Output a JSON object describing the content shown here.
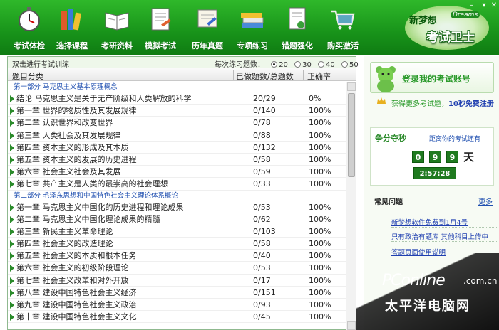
{
  "toolbar": {
    "items": [
      {
        "label": "考试体检",
        "icon": "stopwatch-icon"
      },
      {
        "label": "选择课程",
        "icon": "books-icon"
      },
      {
        "label": "考研资料",
        "icon": "open-book-icon"
      },
      {
        "label": "模拟考试",
        "icon": "exam-paper-icon"
      },
      {
        "label": "历年真题",
        "icon": "scroll-icon"
      },
      {
        "label": "专项练习",
        "icon": "book-stack-icon"
      },
      {
        "label": "错题强化",
        "icon": "document-pen-icon"
      },
      {
        "label": "购买激活",
        "icon": "shopping-cart-icon"
      }
    ],
    "logo": {
      "top": "新梦想",
      "en": "Dreams",
      "main": "考试卫士"
    }
  },
  "panel": {
    "hint": "双击进行考试训练",
    "qcount_label": "每次练习题数：",
    "qcount_options": [
      "20",
      "30",
      "40",
      "50"
    ],
    "qcount_selected": "20",
    "columns": {
      "category": "题目分类",
      "done": "已做题数/总题数",
      "rate": "正确率"
    },
    "sections": [
      {
        "title": "第一部分  马克思主义基本原理概念",
        "rows": [
          {
            "name": "结论  马克思主义是关于无产阶级和人类解放的科学",
            "done": "20/29",
            "rate": "0%"
          },
          {
            "name": "第一章  世界的物质性及其发展规律",
            "done": "0/140",
            "rate": "100%"
          },
          {
            "name": "第二章  认识世界和改变世界",
            "done": "0/78",
            "rate": "100%"
          },
          {
            "name": "第三章  人类社会及其发展规律",
            "done": "0/88",
            "rate": "100%"
          },
          {
            "name": "第四章  资本主义的形成及其本质",
            "done": "0/132",
            "rate": "100%"
          },
          {
            "name": "第五章  资本主义的发展的历史进程",
            "done": "0/58",
            "rate": "100%"
          },
          {
            "name": "第六章  社会主义社会及其发展",
            "done": "0/59",
            "rate": "100%"
          },
          {
            "name": "第七章  共产主义是人类的最崇高的社会理想",
            "done": "0/33",
            "rate": "100%"
          }
        ]
      },
      {
        "title": "第二部分  毛泽东思想和中国特色社会主义理论体系概论",
        "rows": [
          {
            "name": "第一章  马克思主义中国化的历史进程和理论成果",
            "done": "0/53",
            "rate": "100%"
          },
          {
            "name": "第二章  马克思主义中国化理论成果的精髓",
            "done": "0/62",
            "rate": "100%"
          },
          {
            "name": "第三章  新民主主义革命理论",
            "done": "0/103",
            "rate": "100%"
          },
          {
            "name": "第四章  社会主义的改造理论",
            "done": "0/58",
            "rate": "100%"
          },
          {
            "name": "第五章  社会主义的本质和根本任务",
            "done": "0/40",
            "rate": "100%"
          },
          {
            "name": "第六章  社会主义的初级阶段理论",
            "done": "0/53",
            "rate": "100%"
          },
          {
            "name": "第七章  社会主义改革和对外开放",
            "done": "0/17",
            "rate": "100%"
          },
          {
            "name": "第八章  建设中国特色社会主义经济",
            "done": "0/151",
            "rate": "100%"
          },
          {
            "name": "第九章  建设中国特色社会主义政治",
            "done": "0/93",
            "rate": "100%"
          },
          {
            "name": "第十章  建设中国特色社会主义文化",
            "done": "0/45",
            "rate": "100%"
          }
        ]
      }
    ]
  },
  "sidebar": {
    "login": "登录我的考试账号",
    "reg_prefix": "获得更多考试题，",
    "reg_link": "10秒免费注册",
    "countdown": {
      "title": "争分夺秒",
      "subtitle": "距离你的考试还有",
      "days": [
        "0",
        "9",
        "9"
      ],
      "day_unit": "天",
      "time": "2:57:28"
    },
    "faq": {
      "title": "常见问题",
      "more": "更多",
      "items": [
        "新梦想软件免费到1月4号",
        "只有政治有题库 其他科目上传中",
        "答题页面使用说明"
      ]
    }
  },
  "watermark": {
    "brand": "PConline",
    "com": ".com.cn",
    "cn": "太平洋电脑网"
  },
  "colors": {
    "toolbar_green": "#18931a",
    "accent_blue": "#1f4fb0",
    "row_arrow": "#2a8a2a"
  }
}
